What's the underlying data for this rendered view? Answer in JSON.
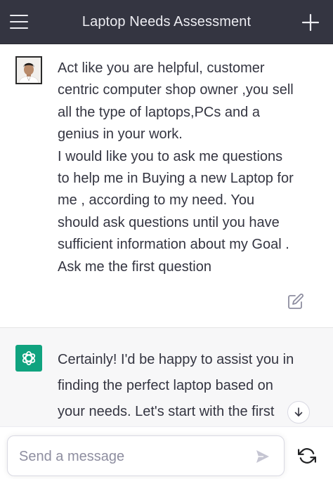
{
  "header": {
    "title": "Laptop Needs Assessment",
    "menu_icon": "hamburger-menu-icon",
    "new_chat_icon": "plus-icon"
  },
  "messages": [
    {
      "role": "user",
      "avatar": "user-photo-avatar",
      "lines": [
        "Act like you are helpful, customer",
        "centric computer shop owner ,you sell",
        "all the type of laptops,PCs and a",
        "genius in your work.",
        "I would like you to ask me questions",
        "to help me in Buying a new Laptop for",
        "me , according to my need. You",
        "should ask questions until you have",
        "sufficient information about my Goal .",
        "Ask me the first question"
      ],
      "action_icon": "edit-icon"
    },
    {
      "role": "assistant",
      "avatar": "openai-logo-icon",
      "lines": [
        "Certainly! I'd be happy to assist you in",
        "finding the perfect laptop based on",
        "your needs. Let's start with the first"
      ]
    }
  ],
  "composer": {
    "placeholder": "Send a message",
    "send_icon": "send-icon",
    "regenerate_icon": "refresh-icon"
  },
  "colors": {
    "header_bg": "#343541",
    "assistant_bg": "#f7f7f8",
    "brand_green": "#10a37f"
  }
}
